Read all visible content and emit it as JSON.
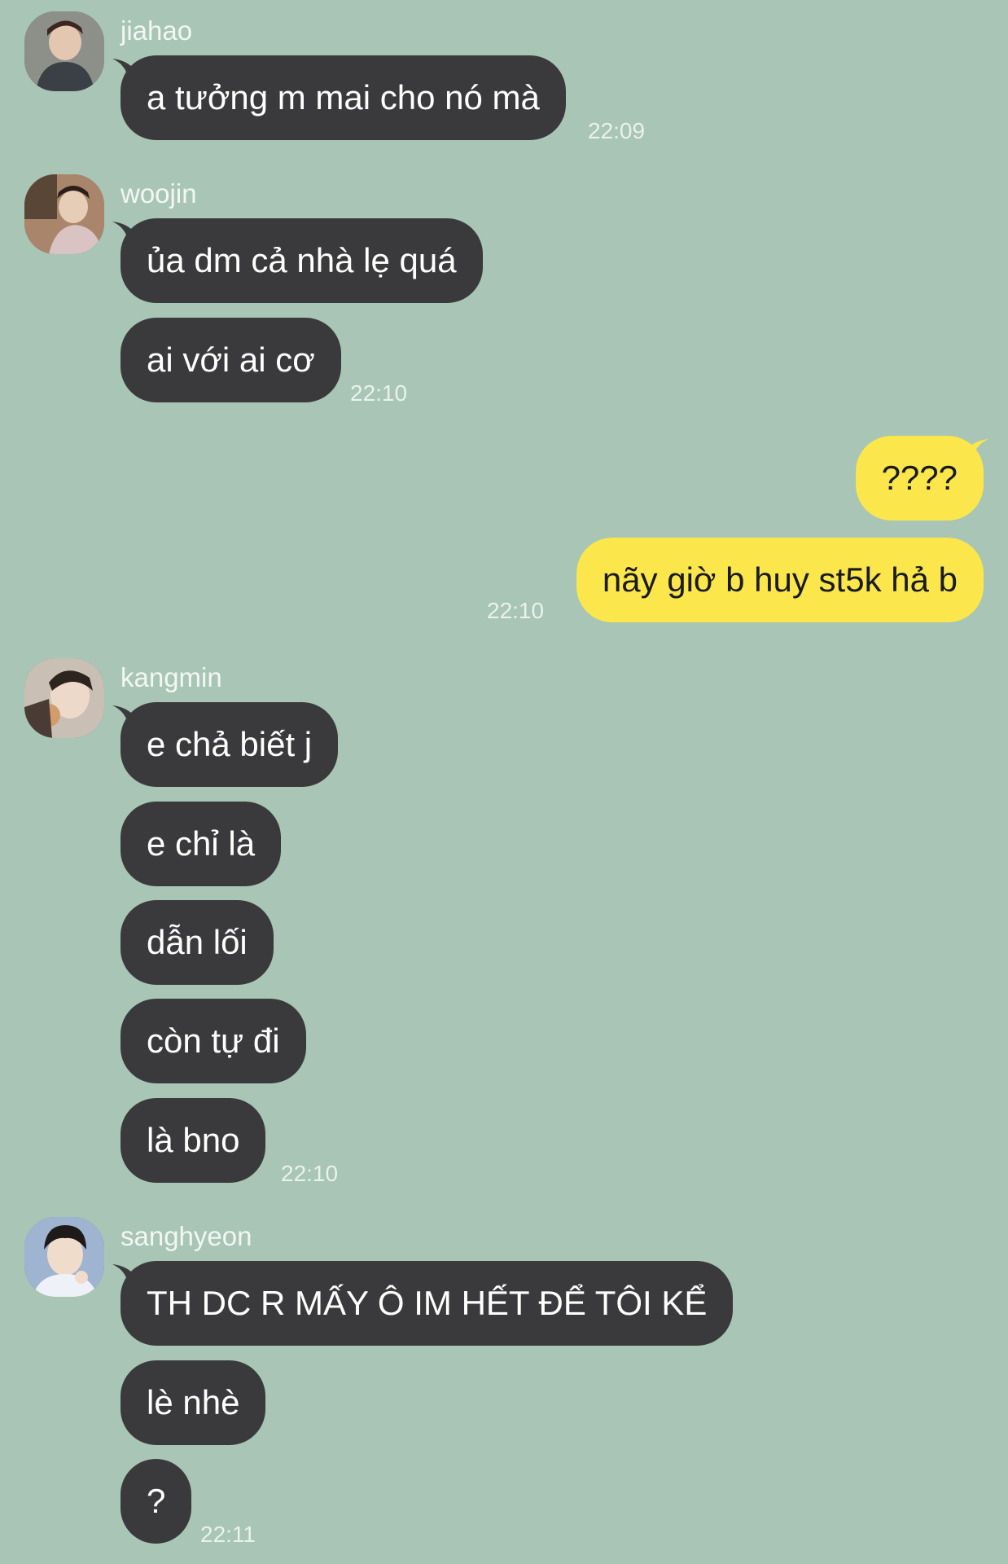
{
  "groups": [
    {
      "sender": "jiahao",
      "messages": [
        "a tưởng m mai cho nó mà"
      ],
      "time": "22:09"
    },
    {
      "sender": "woojin",
      "messages": [
        "ủa dm cả nhà lẹ quá",
        "ai với ai cơ"
      ],
      "time": "22:10"
    },
    {
      "sender": "me",
      "messages": [
        "????",
        "nãy giờ b huy st5k hả b"
      ],
      "time": "22:10"
    },
    {
      "sender": "kangmin",
      "messages": [
        "e chả biết j",
        "e chỉ là",
        "dẫn lối",
        "còn tự đi",
        "là bno"
      ],
      "time": "22:10"
    },
    {
      "sender": "sanghyeon",
      "messages": [
        "TH DC R MẤY Ô IM HẾT ĐỂ TÔI KỂ",
        "lè nhè",
        "?"
      ],
      "time": "22:11"
    }
  ],
  "colors": {
    "background": "#a8c5b5",
    "incoming_bubble": "#3a3a3c",
    "outgoing_bubble": "#fbe74b"
  }
}
